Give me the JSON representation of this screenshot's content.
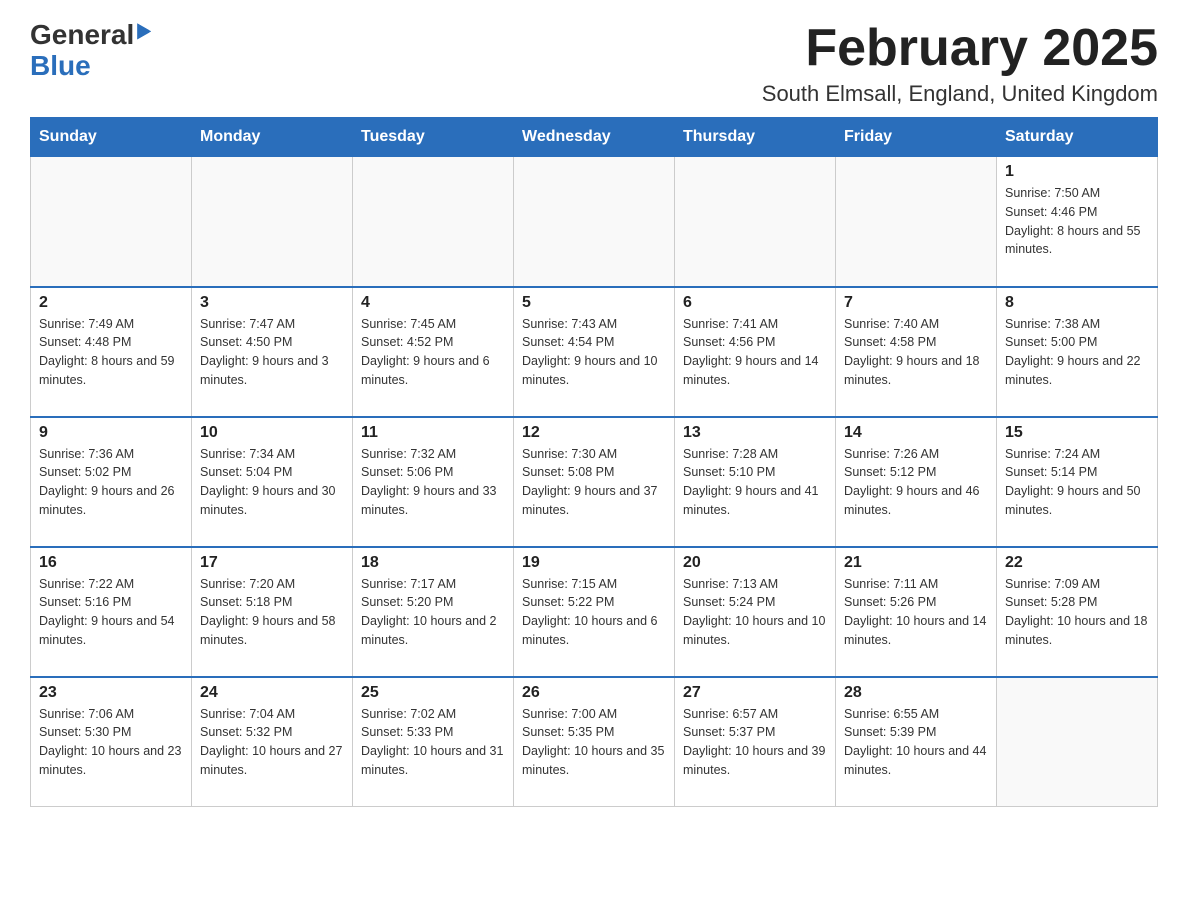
{
  "header": {
    "logo_line1": "General",
    "logo_line2": "Blue",
    "month_title": "February 2025",
    "location": "South Elmsall, England, United Kingdom"
  },
  "days_of_week": [
    "Sunday",
    "Monday",
    "Tuesday",
    "Wednesday",
    "Thursday",
    "Friday",
    "Saturday"
  ],
  "weeks": [
    [
      {
        "day": "",
        "info": ""
      },
      {
        "day": "",
        "info": ""
      },
      {
        "day": "",
        "info": ""
      },
      {
        "day": "",
        "info": ""
      },
      {
        "day": "",
        "info": ""
      },
      {
        "day": "",
        "info": ""
      },
      {
        "day": "1",
        "info": "Sunrise: 7:50 AM\nSunset: 4:46 PM\nDaylight: 8 hours and 55 minutes."
      }
    ],
    [
      {
        "day": "2",
        "info": "Sunrise: 7:49 AM\nSunset: 4:48 PM\nDaylight: 8 hours and 59 minutes."
      },
      {
        "day": "3",
        "info": "Sunrise: 7:47 AM\nSunset: 4:50 PM\nDaylight: 9 hours and 3 minutes."
      },
      {
        "day": "4",
        "info": "Sunrise: 7:45 AM\nSunset: 4:52 PM\nDaylight: 9 hours and 6 minutes."
      },
      {
        "day": "5",
        "info": "Sunrise: 7:43 AM\nSunset: 4:54 PM\nDaylight: 9 hours and 10 minutes."
      },
      {
        "day": "6",
        "info": "Sunrise: 7:41 AM\nSunset: 4:56 PM\nDaylight: 9 hours and 14 minutes."
      },
      {
        "day": "7",
        "info": "Sunrise: 7:40 AM\nSunset: 4:58 PM\nDaylight: 9 hours and 18 minutes."
      },
      {
        "day": "8",
        "info": "Sunrise: 7:38 AM\nSunset: 5:00 PM\nDaylight: 9 hours and 22 minutes."
      }
    ],
    [
      {
        "day": "9",
        "info": "Sunrise: 7:36 AM\nSunset: 5:02 PM\nDaylight: 9 hours and 26 minutes."
      },
      {
        "day": "10",
        "info": "Sunrise: 7:34 AM\nSunset: 5:04 PM\nDaylight: 9 hours and 30 minutes."
      },
      {
        "day": "11",
        "info": "Sunrise: 7:32 AM\nSunset: 5:06 PM\nDaylight: 9 hours and 33 minutes."
      },
      {
        "day": "12",
        "info": "Sunrise: 7:30 AM\nSunset: 5:08 PM\nDaylight: 9 hours and 37 minutes."
      },
      {
        "day": "13",
        "info": "Sunrise: 7:28 AM\nSunset: 5:10 PM\nDaylight: 9 hours and 41 minutes."
      },
      {
        "day": "14",
        "info": "Sunrise: 7:26 AM\nSunset: 5:12 PM\nDaylight: 9 hours and 46 minutes."
      },
      {
        "day": "15",
        "info": "Sunrise: 7:24 AM\nSunset: 5:14 PM\nDaylight: 9 hours and 50 minutes."
      }
    ],
    [
      {
        "day": "16",
        "info": "Sunrise: 7:22 AM\nSunset: 5:16 PM\nDaylight: 9 hours and 54 minutes."
      },
      {
        "day": "17",
        "info": "Sunrise: 7:20 AM\nSunset: 5:18 PM\nDaylight: 9 hours and 58 minutes."
      },
      {
        "day": "18",
        "info": "Sunrise: 7:17 AM\nSunset: 5:20 PM\nDaylight: 10 hours and 2 minutes."
      },
      {
        "day": "19",
        "info": "Sunrise: 7:15 AM\nSunset: 5:22 PM\nDaylight: 10 hours and 6 minutes."
      },
      {
        "day": "20",
        "info": "Sunrise: 7:13 AM\nSunset: 5:24 PM\nDaylight: 10 hours and 10 minutes."
      },
      {
        "day": "21",
        "info": "Sunrise: 7:11 AM\nSunset: 5:26 PM\nDaylight: 10 hours and 14 minutes."
      },
      {
        "day": "22",
        "info": "Sunrise: 7:09 AM\nSunset: 5:28 PM\nDaylight: 10 hours and 18 minutes."
      }
    ],
    [
      {
        "day": "23",
        "info": "Sunrise: 7:06 AM\nSunset: 5:30 PM\nDaylight: 10 hours and 23 minutes."
      },
      {
        "day": "24",
        "info": "Sunrise: 7:04 AM\nSunset: 5:32 PM\nDaylight: 10 hours and 27 minutes."
      },
      {
        "day": "25",
        "info": "Sunrise: 7:02 AM\nSunset: 5:33 PM\nDaylight: 10 hours and 31 minutes."
      },
      {
        "day": "26",
        "info": "Sunrise: 7:00 AM\nSunset: 5:35 PM\nDaylight: 10 hours and 35 minutes."
      },
      {
        "day": "27",
        "info": "Sunrise: 6:57 AM\nSunset: 5:37 PM\nDaylight: 10 hours and 39 minutes."
      },
      {
        "day": "28",
        "info": "Sunrise: 6:55 AM\nSunset: 5:39 PM\nDaylight: 10 hours and 44 minutes."
      },
      {
        "day": "",
        "info": ""
      }
    ]
  ]
}
